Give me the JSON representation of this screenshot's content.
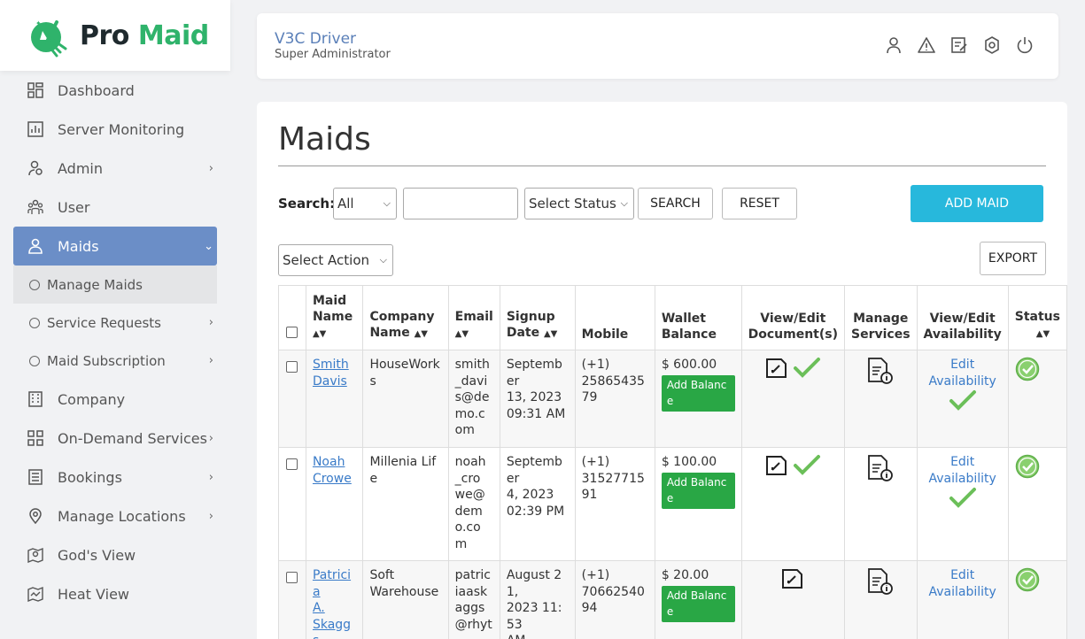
{
  "brand": {
    "pro": "Pro",
    "maid": "Maid"
  },
  "sidebar": {
    "items": [
      {
        "label": "Dashboard",
        "icon": "dashboard-icon"
      },
      {
        "label": "Server Monitoring",
        "icon": "chart-icon"
      },
      {
        "label": "Admin",
        "icon": "admin-icon"
      },
      {
        "label": "User",
        "icon": "users-icon"
      },
      {
        "label": "Maids",
        "icon": "user-icon"
      },
      {
        "label": "Manage Maids"
      },
      {
        "label": "Service Requests"
      },
      {
        "label": "Maid Subscription"
      },
      {
        "label": "Company",
        "icon": "building-icon"
      },
      {
        "label": "On-Demand Services",
        "icon": "grid-icon"
      },
      {
        "label": "Bookings",
        "icon": "list-icon"
      },
      {
        "label": "Manage Locations",
        "icon": "location-icon"
      },
      {
        "label": "God's View",
        "icon": "map-pin-icon"
      },
      {
        "label": "Heat View",
        "icon": "heat-map-icon"
      }
    ]
  },
  "header": {
    "name": "V3C Driver",
    "role": "Super Administrator"
  },
  "page": {
    "title": "Maids"
  },
  "search": {
    "label": "Search:",
    "field_select": "All",
    "status_select": "Select Status",
    "search_btn": "SEARCH",
    "reset_btn": "RESET",
    "add_btn": "ADD MAID",
    "action_select": "Select Action",
    "export_btn": "EXPORT"
  },
  "table": {
    "headers": {
      "maid_name": [
        "Maid",
        "Name"
      ],
      "company": [
        "Company",
        "Name"
      ],
      "email": [
        "Email"
      ],
      "signup": [
        "Signup",
        "Date"
      ],
      "mobile": [
        "Mobile"
      ],
      "wallet": [
        "Wallet",
        "Balance"
      ],
      "docs": [
        "View/Edit",
        "Document(s)"
      ],
      "services": [
        "Manage",
        "Services"
      ],
      "availability": [
        "View/Edit",
        "Availability"
      ],
      "status": [
        "Status"
      ]
    },
    "add_balance": "Add Balance",
    "edit_availability": [
      "Edit",
      "Availability"
    ],
    "rows": [
      {
        "name": [
          "Smith",
          "Davis"
        ],
        "company": [
          "HouseWorks"
        ],
        "email": [
          "smith",
          "_davi",
          "s@de",
          "mo.c",
          "om"
        ],
        "signup": [
          "September",
          "13, 2023",
          "09:31 AM"
        ],
        "mobile": [
          "(+1)",
          "2586543579"
        ],
        "wallet": "$ 600.00",
        "doc_verified": true,
        "avail_verified": true
      },
      {
        "name": [
          "Noah",
          "Crowe"
        ],
        "company": [
          "Millenia Life"
        ],
        "email": [
          "noah",
          "_cro",
          "we@",
          "dem",
          "o.co",
          "m"
        ],
        "signup": [
          "September",
          "4, 2023",
          "02:39 PM"
        ],
        "mobile": [
          "(+1)",
          "3152771591"
        ],
        "wallet": "$ 100.00",
        "doc_verified": true,
        "avail_verified": true
      },
      {
        "name": [
          "Patricia",
          "A.",
          "Skaggs"
        ],
        "company": [
          "Soft",
          "Warehouse"
        ],
        "email": [
          "patric",
          "iaask",
          "aggs",
          "@rhyt"
        ],
        "signup": [
          "August 21,",
          "2023 11:53",
          "AM"
        ],
        "mobile": [
          "(+1)",
          "7066254094"
        ],
        "wallet": "$ 20.00",
        "doc_verified": false,
        "avail_verified": false
      }
    ]
  }
}
